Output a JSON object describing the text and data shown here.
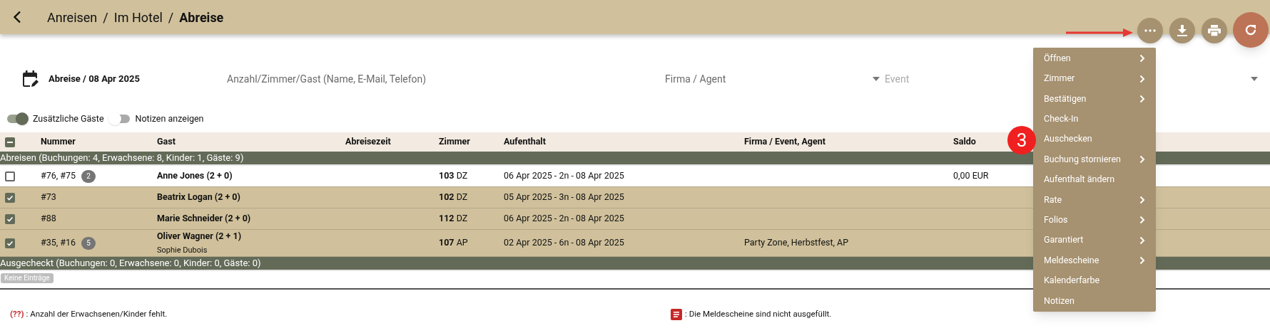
{
  "header": {
    "breadcrumb": [
      "Anreisen",
      "Im Hotel"
    ],
    "current": "Abreise",
    "separator": "/"
  },
  "filters": {
    "date_label": "Abreise / 08 Apr 2025",
    "search": {
      "placeholder": "Anzahl/Zimmer/Gast (Name, E-Mail, Telefon)"
    },
    "company": {
      "placeholder": "Firma / Agent"
    },
    "event": {
      "placeholder": "Event"
    }
  },
  "toggles": [
    {
      "label": "Zusätzliche Gäste",
      "on": true
    },
    {
      "label": "Notizen anzeigen",
      "on": false
    }
  ],
  "table": {
    "select_all_indeterminate": true,
    "columns": [
      "Nummer",
      "Gast",
      "Abreisezeit",
      "Zimmer",
      "Aufenthalt",
      "Firma / Event, Agent",
      "Saldo"
    ],
    "groups": [
      {
        "title": "Abreisen (Buchungen: 4, Erwachsene: 8, Kinder: 1, Gäste: 9)",
        "rows": [
          {
            "selected": false,
            "number": "#76, #75",
            "badge": "2",
            "guest": "Anne Jones (2 + 0)",
            "room": "103",
            "room_type": "DZ",
            "stay": "06 Apr 2025 - 2n - 08 Apr 2025",
            "saldo": "0,00 EUR"
          },
          {
            "selected": true,
            "number": "#73",
            "guest": "Beatrix Logan (2 + 0)",
            "room": "102",
            "room_type": "DZ",
            "stay": "05 Apr 2025 - 3n - 08 Apr 2025"
          },
          {
            "selected": true,
            "number": "#88",
            "guest": "Marie Schneider (2 + 0)",
            "room": "112",
            "room_type": "DZ",
            "stay": "06 Apr 2025 - 2n - 08 Apr 2025"
          },
          {
            "selected": true,
            "number": "#35, #16",
            "badge": "5",
            "guest": "Oliver Wagner (2 + 1)",
            "extra_guest": "Sophie Dubois",
            "room": "107",
            "room_type": "AP",
            "stay": "02 Apr 2025 - 6n - 08 Apr 2025",
            "company": "Party Zone, Herbstfest, AP"
          }
        ]
      },
      {
        "title": "Ausgecheckt (Buchungen: 0, Erwachsene: 0, Kinder: 0, Gäste: 0)",
        "empty": "Keine Einträge"
      }
    ]
  },
  "legend": [
    {
      "kind": "marker",
      "marker": "(??)",
      "text": ": Anzahl der Erwachsenen/Kinder fehlt."
    },
    {
      "kind": "icon",
      "text": ": Die Meldescheine sind nicht ausgefüllt."
    }
  ],
  "menu": {
    "items": [
      {
        "label": "Öffnen",
        "submenu": true
      },
      {
        "label": "Zimmer",
        "submenu": true
      },
      {
        "label": "Bestätigen",
        "submenu": true
      },
      {
        "label": "Check-In",
        "submenu": false
      },
      {
        "label": "Auschecken",
        "submenu": false
      },
      {
        "label": "Buchung stornieren",
        "submenu": true
      },
      {
        "label": "Aufenthalt ändern",
        "submenu": false
      },
      {
        "label": "Rate",
        "submenu": true
      },
      {
        "label": "Folios",
        "submenu": true
      },
      {
        "label": "Garantiert",
        "submenu": true
      },
      {
        "label": "Meldescheine",
        "submenu": true
      },
      {
        "label": "Kalenderfarbe",
        "submenu": false
      },
      {
        "label": "Notizen",
        "submenu": false
      }
    ]
  },
  "step_badge": "3"
}
